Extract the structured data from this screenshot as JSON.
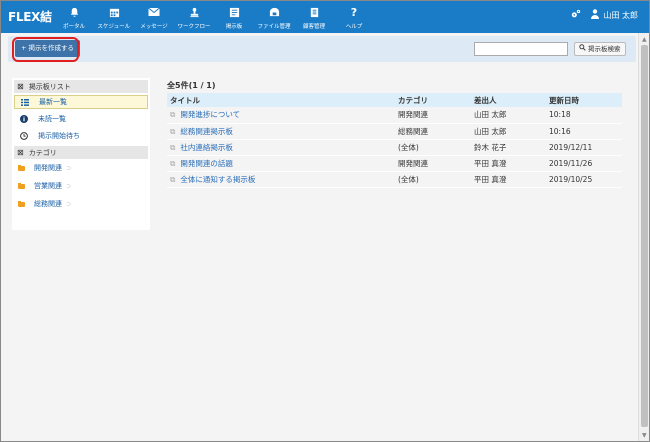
{
  "app": {
    "logo": "FLEX結"
  },
  "nav": [
    {
      "label": "ポータル",
      "icon": "bell-icon"
    },
    {
      "label": "スケジュール",
      "icon": "calendar-icon"
    },
    {
      "label": "メッセージ",
      "icon": "envelope-icon"
    },
    {
      "label": "ワークフロー",
      "icon": "stamp-icon"
    },
    {
      "label": "掲示板",
      "icon": "board-icon"
    },
    {
      "label": "ファイル管理",
      "icon": "file-icon"
    },
    {
      "label": "顧客管理",
      "icon": "customer-icon"
    },
    {
      "label": "ヘルプ",
      "icon": "question-icon"
    }
  ],
  "user": {
    "name": "山田 太郎"
  },
  "toolbar": {
    "create_label": "+ 掲示を作成する",
    "search_placeholder": "",
    "search_label": "掲示板検索"
  },
  "sidebar": {
    "list_header": "掲示板リスト",
    "items": [
      {
        "label": "最新一覧",
        "active": true
      },
      {
        "label": "未読一覧"
      },
      {
        "label": "掲示開始待ち"
      }
    ],
    "category_header": "カテゴリ",
    "categories": [
      {
        "label": "開発関連"
      },
      {
        "label": "営業関連"
      },
      {
        "label": "総務関連"
      }
    ]
  },
  "main": {
    "count": "全5件(1 / 1)",
    "columns": [
      "タイトル",
      "カテゴリ",
      "差出人",
      "更新日時"
    ],
    "rows": [
      {
        "title": "開発進捗について",
        "category": "開発関連",
        "sender": "山田 太郎",
        "updated": "10:18"
      },
      {
        "title": "総務関連掲示板",
        "category": "総務関連",
        "sender": "山田 太郎",
        "updated": "10:16"
      },
      {
        "title": "社内連絡掲示板",
        "category": "(全体)",
        "sender": "鈴木 花子",
        "updated": "2019/12/11"
      },
      {
        "title": "開発関連の話題",
        "category": "開発関連",
        "sender": "平田 真澄",
        "updated": "2019/11/26"
      },
      {
        "title": "全体に通知する掲示板",
        "category": "(全体)",
        "sender": "平田 真澄",
        "updated": "2019/10/25"
      }
    ]
  },
  "colors": {
    "topbar": "#1a7cc7",
    "accent_button": "#3d73a8",
    "link": "#2a6eb7",
    "highlight": "#e02020"
  }
}
